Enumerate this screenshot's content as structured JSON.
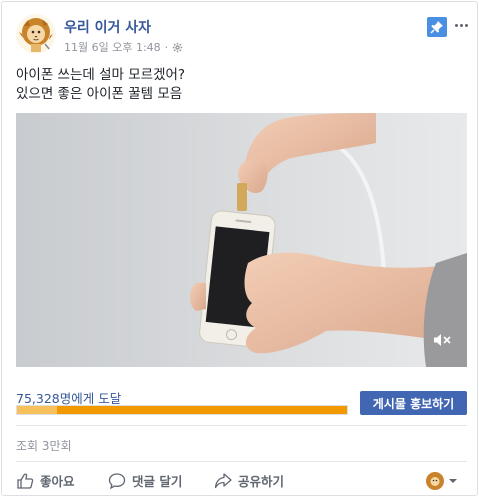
{
  "post": {
    "page_name": "우리 이거 사자",
    "timestamp": "11월 6일 오후 1:48",
    "meta_separator": "·",
    "text_line1": "아이폰 쓰는데 설마 모르겠어?",
    "text_line2": "있으면 좋은 아이폰 꿀템 모음"
  },
  "reach": {
    "label": "75,328명에게 도달",
    "organic_fraction": 0.12,
    "paid_fraction": 0.88,
    "boost_label": "게시물 홍보하기"
  },
  "stats": {
    "views": "조회 3만회"
  },
  "actions": {
    "like": "좋아요",
    "comment": "댓글 달기",
    "share": "공유하기"
  },
  "colors": {
    "page_name": "#365899",
    "boost": "#4267b2",
    "reach_orange": "#f29900",
    "pin": "#4a90e2"
  }
}
